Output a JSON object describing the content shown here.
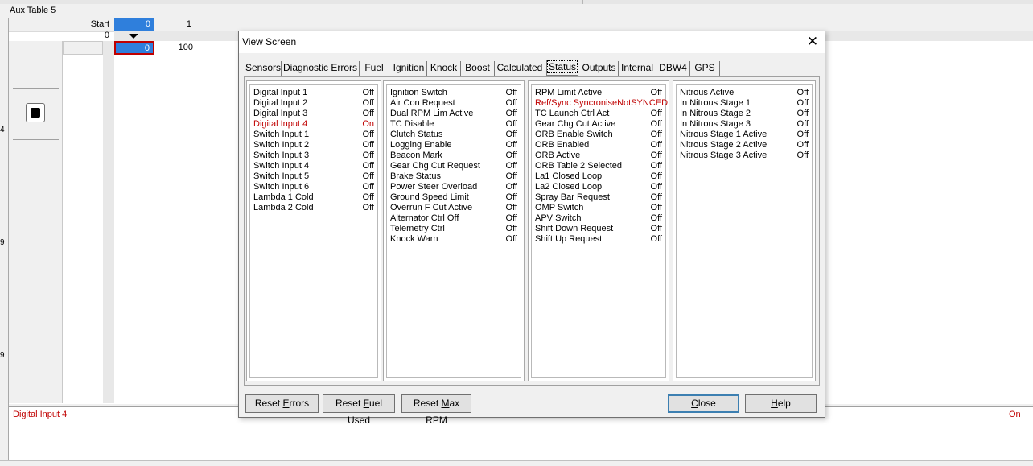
{
  "window": {
    "title": "Aux Table 5"
  },
  "table": {
    "start_label": "Start",
    "start_value": "0",
    "start_value2": "1",
    "row_label": "0",
    "cell_value": "0",
    "cell_value2": "100"
  },
  "left_edge_marks": [
    "4",
    "9",
    "9"
  ],
  "status_bar": {
    "label": "Digital Input 4",
    "value": "On"
  },
  "dialog": {
    "title": "View Screen",
    "close_glyph": "✕",
    "tabs": [
      "Sensors",
      "Diagnostic Errors",
      "Fuel",
      "Ignition",
      "Knock",
      "Boost",
      "Calculated",
      "Status",
      "Outputs",
      "Internal",
      "DBW4",
      "GPS"
    ],
    "active_tab": "Status",
    "columns": [
      [
        {
          "name": "Digital Input 1",
          "value": "Off"
        },
        {
          "name": "Digital Input 2",
          "value": "Off"
        },
        {
          "name": "Digital Input 3",
          "value": "Off"
        },
        {
          "name": "Digital Input 4",
          "value": "On",
          "alert": true
        },
        {
          "name": "Switch Input 1",
          "value": "Off"
        },
        {
          "name": "Switch Input 2",
          "value": "Off"
        },
        {
          "name": "Switch Input 3",
          "value": "Off"
        },
        {
          "name": "Switch Input 4",
          "value": "Off"
        },
        {
          "name": "Switch Input 5",
          "value": "Off"
        },
        {
          "name": "Switch Input 6",
          "value": "Off"
        },
        {
          "name": "Lambda 1 Cold",
          "value": "Off"
        },
        {
          "name": "Lambda 2 Cold",
          "value": "Off"
        }
      ],
      [
        {
          "name": "Ignition Switch",
          "value": "Off"
        },
        {
          "name": "Air Con Request",
          "value": "Off"
        },
        {
          "name": "Dual RPM Lim Active",
          "value": "Off"
        },
        {
          "name": "TC Disable",
          "value": "Off"
        },
        {
          "name": "Clutch Status",
          "value": "Off"
        },
        {
          "name": "Logging Enable",
          "value": "Off"
        },
        {
          "name": "Beacon Mark",
          "value": "Off"
        },
        {
          "name": "Gear Chg Cut Request",
          "value": "Off"
        },
        {
          "name": "Brake Status",
          "value": "Off"
        },
        {
          "name": "Power Steer Overload",
          "value": "Off"
        },
        {
          "name": "Ground Speed Limit",
          "value": "Off"
        },
        {
          "name": "Overrun F Cut Active",
          "value": "Off"
        },
        {
          "name": "Alternator Ctrl Off",
          "value": "Off"
        },
        {
          "name": "Telemetry Ctrl",
          "value": "Off"
        },
        {
          "name": "Knock Warn",
          "value": "Off"
        }
      ],
      [
        {
          "name": "RPM Limit Active",
          "value": "Off"
        },
        {
          "name": "Ref/Sync SyncroniseNotSYNCED",
          "value": "",
          "alert": true
        },
        {
          "name": "TC Launch Ctrl Act",
          "value": "Off"
        },
        {
          "name": "Gear Chg Cut Active",
          "value": "Off"
        },
        {
          "name": "ORB Enable Switch",
          "value": "Off"
        },
        {
          "name": "ORB Enabled",
          "value": "Off"
        },
        {
          "name": "ORB Active",
          "value": "Off"
        },
        {
          "name": "ORB Table 2 Selected",
          "value": "Off"
        },
        {
          "name": "La1 Closed Loop",
          "value": "Off"
        },
        {
          "name": "La2 Closed Loop",
          "value": "Off"
        },
        {
          "name": "Spray Bar Request",
          "value": "Off"
        },
        {
          "name": "OMP Switch",
          "value": "Off"
        },
        {
          "name": "APV Switch",
          "value": "Off"
        },
        {
          "name": "Shift Down Request",
          "value": "Off"
        },
        {
          "name": "Shift Up Request",
          "value": "Off"
        }
      ],
      [
        {
          "name": "Nitrous Active",
          "value": "Off"
        },
        {
          "name": "In Nitrous Stage 1",
          "value": "Off"
        },
        {
          "name": "In Nitrous Stage 2",
          "value": "Off"
        },
        {
          "name": "In Nitrous Stage 3",
          "value": "Off"
        },
        {
          "name": "Nitrous Stage 1 Active",
          "value": "Off"
        },
        {
          "name": "Nitrous Stage 2 Active",
          "value": "Off"
        },
        {
          "name": "Nitrous Stage 3 Active",
          "value": "Off"
        }
      ]
    ],
    "buttons": {
      "reset_errors": {
        "pre": "Reset ",
        "u": "E",
        "post": "rrors"
      },
      "reset_fuel": {
        "pre": "Reset ",
        "u": "F",
        "post": "uel Used"
      },
      "reset_rpm": {
        "pre": "Reset ",
        "u": "M",
        "post": "ax RPM"
      },
      "close": {
        "pre": "",
        "u": "C",
        "post": "lose"
      },
      "help": {
        "pre": "",
        "u": "H",
        "post": "elp"
      }
    }
  },
  "colors": {
    "alert": "#c00000",
    "selection": "#2f7fdc"
  }
}
